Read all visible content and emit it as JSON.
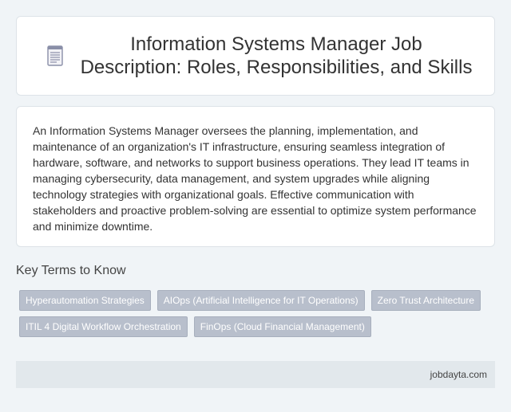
{
  "header": {
    "icon": "document-icon",
    "title": "Information Systems Manager Job Description: Roles, Responsibilities, and Skills"
  },
  "description": {
    "text": "An Information Systems Manager oversees the planning, implementation, and maintenance of an organization's IT infrastructure, ensuring seamless integration of hardware, software, and networks to support business operations. They lead IT teams in managing cybersecurity, data management, and system upgrades while aligning technology strategies with organizational goals. Effective communication with stakeholders and proactive problem-solving are essential to optimize system performance and minimize downtime."
  },
  "key_terms": {
    "heading": "Key Terms to Know",
    "tags": [
      "Hyperautomation Strategies",
      "AIOps (Artificial Intelligence for IT Operations)",
      "Zero Trust Architecture",
      "ITIL 4 Digital Workflow Orchestration",
      "FinOps (Cloud Financial Management)"
    ]
  },
  "footer": {
    "site": "jobdayta.com"
  },
  "colors": {
    "page_background": "#f0f4f7",
    "card_background": "#ffffff",
    "tag_background": "#b8bfcc",
    "footer_background": "#e2e8ec"
  }
}
